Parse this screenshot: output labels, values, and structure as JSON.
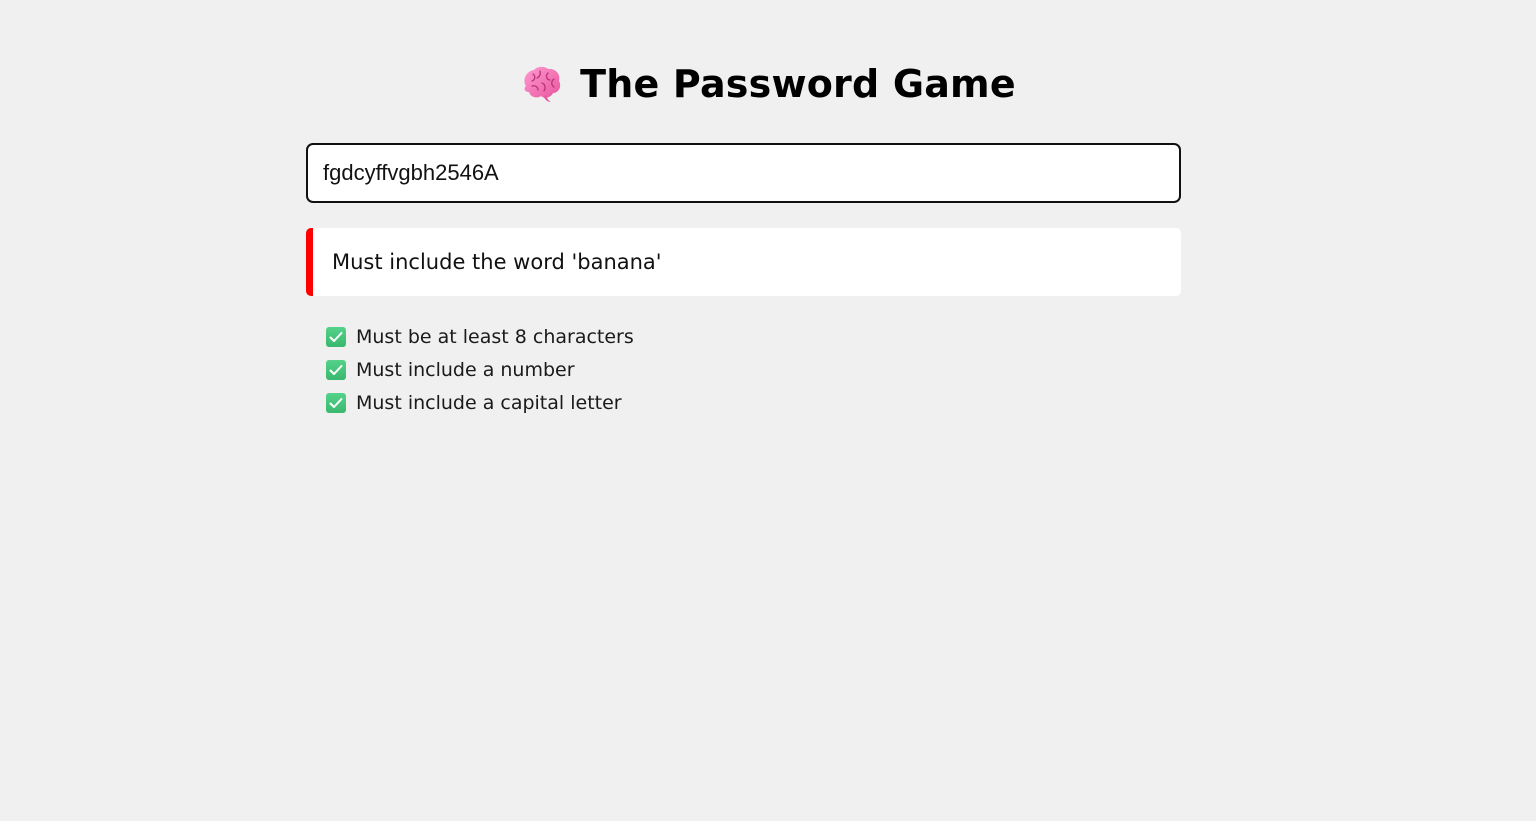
{
  "header": {
    "icon": "brain-icon",
    "title": "The Password Game"
  },
  "password": {
    "value": "fgdcyffvgbh2546A"
  },
  "failed_rule": {
    "text": "Must include the word 'banana'",
    "status_color": "#ff0000"
  },
  "passed_rules": [
    {
      "icon": "check-icon",
      "text": "Must be at least 8 characters"
    },
    {
      "icon": "check-icon",
      "text": "Must include a number"
    },
    {
      "icon": "check-icon",
      "text": "Must include a capital letter"
    }
  ],
  "colors": {
    "background": "#f0f0f0",
    "check": "#3bb86f",
    "fail_bar": "#ff0000"
  }
}
